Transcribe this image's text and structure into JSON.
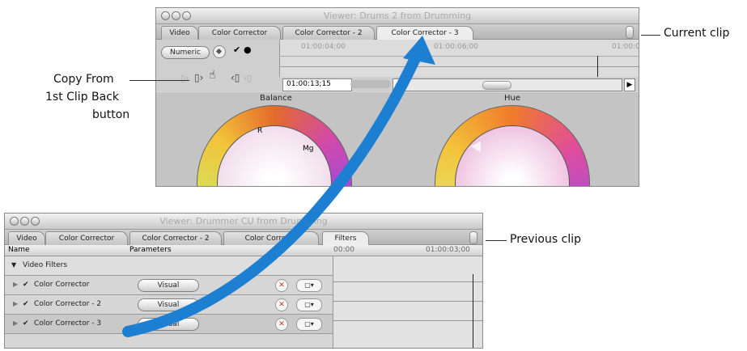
{
  "top_viewer": {
    "title": "Viewer: Drums 2 from Drumming",
    "tabs": [
      "Video",
      "Color Corrector",
      "Color Corrector - 2",
      "Color Corrector - 3"
    ],
    "numeric_label": "Numeric",
    "timecode_top": [
      "01:00:04;00",
      "01:00:06;00",
      "01:00:0"
    ],
    "current_timecode": "01:00:13;15",
    "wheel_balance": "Balance",
    "wheel_hue": "Hue",
    "balance_marks": [
      "R",
      "Mg",
      "Yl"
    ]
  },
  "bottom_viewer": {
    "title": "Viewer: Drummer CU from Drumming",
    "tabs": [
      "Video",
      "Color Corrector",
      "Color Corrector - 2",
      "Color Correcto",
      "Filters"
    ],
    "col_name": "Name",
    "col_params": "Parameters",
    "col_nav": "N",
    "ruler": [
      "00:00",
      "01:00:03;00"
    ],
    "group_label": "Video Filters",
    "rows": [
      {
        "name": "Color Corrector",
        "button": "Visual"
      },
      {
        "name": "Color Corrector - 2",
        "button": "Visual"
      },
      {
        "name": "Color Corrector - 3",
        "button": "Visual"
      }
    ]
  },
  "callouts": {
    "current_clip": "Current clip",
    "copy_from_1": "Copy From",
    "copy_from_2": "1st Clip Back",
    "copy_from_3": "button",
    "previous_clip": "Previous clip"
  },
  "colors": {
    "arrow": "#1d7fd1",
    "window_bg": "#d9d9d9"
  }
}
